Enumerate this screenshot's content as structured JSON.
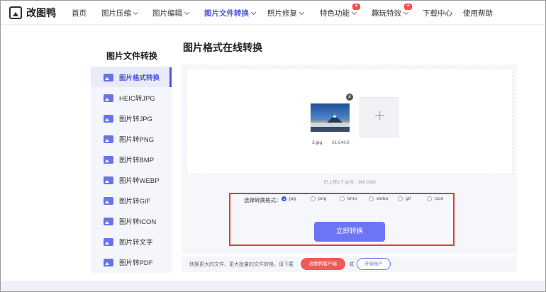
{
  "brand": {
    "name": "改图鸭"
  },
  "nav": {
    "items": [
      {
        "label": "首页",
        "has_dropdown": false,
        "active": false
      },
      {
        "label": "图片压缩",
        "has_dropdown": true,
        "active": false
      },
      {
        "label": "图片编辑",
        "has_dropdown": true,
        "active": false
      },
      {
        "label": "图片文件转换",
        "has_dropdown": true,
        "active": true
      },
      {
        "label": "照片修复",
        "has_dropdown": true,
        "active": false
      },
      {
        "label": "特色功能",
        "has_dropdown": true,
        "active": false,
        "badge": "hot"
      },
      {
        "label": "趣玩特效",
        "has_dropdown": true,
        "active": false,
        "badge": "hot"
      },
      {
        "label": "下载中心",
        "has_dropdown": false,
        "active": false
      },
      {
        "label": "使用帮助",
        "has_dropdown": false,
        "active": false
      }
    ]
  },
  "sidebar": {
    "title": "图片文件转换",
    "items": [
      {
        "label": "图片格式转换",
        "active": true
      },
      {
        "label": "HEIC转JPG"
      },
      {
        "label": "图片转JPG"
      },
      {
        "label": "图片转PNG"
      },
      {
        "label": "图片转BMP"
      },
      {
        "label": "图片转WEBP"
      },
      {
        "label": "图片转GIF"
      },
      {
        "label": "图片转ICON"
      },
      {
        "label": "图片转文字"
      },
      {
        "label": "图片转PDF"
      }
    ]
  },
  "main": {
    "title": "图片格式在线转换",
    "file": {
      "name": "3.jpg",
      "size": "81.64KB"
    },
    "upload_summary": "已上传1个文件，共0.08M",
    "format_label": "选择转换格式：",
    "formats": [
      "jpg",
      "png",
      "bmp",
      "webp",
      "gif",
      "icon"
    ],
    "selected_format": "jpg",
    "convert_button": "立即转换"
  },
  "promo": {
    "text": "转换更大的文件、更大批量的文件转换，请下载",
    "client_button": "改图鸭客户端",
    "or": "或",
    "upgrade_button": "升级账户"
  },
  "colors": {
    "accent": "#4b55e6",
    "button": "#6c76f4",
    "highlight_border": "#e23a3a",
    "client_button": "#f05a5a"
  }
}
